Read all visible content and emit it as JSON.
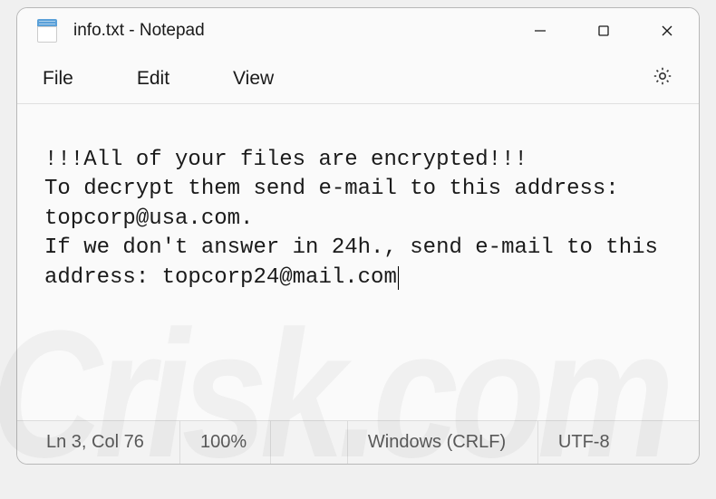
{
  "titlebar": {
    "title": "info.txt - Notepad"
  },
  "menubar": {
    "items": [
      "File",
      "Edit",
      "View"
    ]
  },
  "content": {
    "text": "!!!All of your files are encrypted!!!\nTo decrypt them send e-mail to this address: topcorp@usa.com.\nIf we don't answer in 24h., send e-mail to this address: topcorp24@mail.com"
  },
  "statusbar": {
    "position": "Ln 3, Col 76",
    "zoom": "100%",
    "line_ending": "Windows (CRLF)",
    "encoding": "UTF-8"
  }
}
